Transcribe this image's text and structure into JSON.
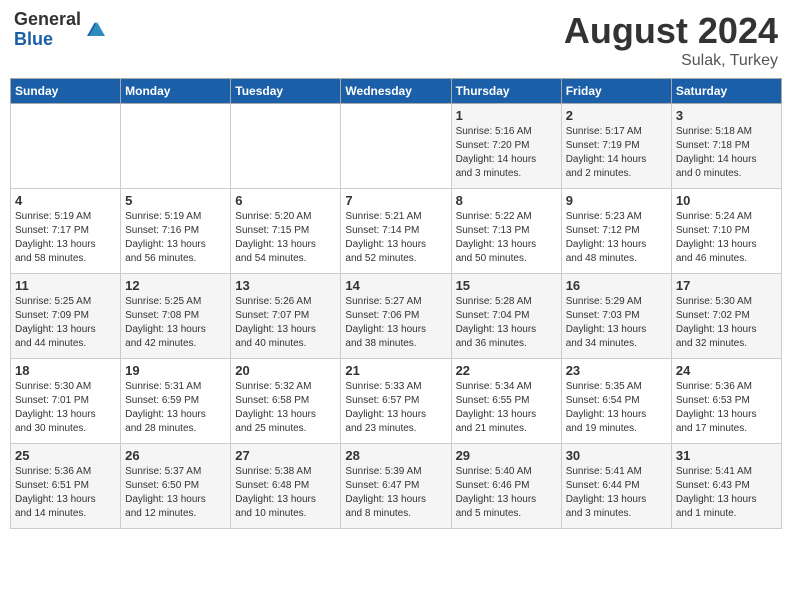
{
  "logo": {
    "general": "General",
    "blue": "Blue"
  },
  "title": "August 2024",
  "location": "Sulak, Turkey",
  "days_of_week": [
    "Sunday",
    "Monday",
    "Tuesday",
    "Wednesday",
    "Thursday",
    "Friday",
    "Saturday"
  ],
  "weeks": [
    [
      {
        "day": "",
        "info": ""
      },
      {
        "day": "",
        "info": ""
      },
      {
        "day": "",
        "info": ""
      },
      {
        "day": "",
        "info": ""
      },
      {
        "day": "1",
        "info": "Sunrise: 5:16 AM\nSunset: 7:20 PM\nDaylight: 14 hours\nand 3 minutes."
      },
      {
        "day": "2",
        "info": "Sunrise: 5:17 AM\nSunset: 7:19 PM\nDaylight: 14 hours\nand 2 minutes."
      },
      {
        "day": "3",
        "info": "Sunrise: 5:18 AM\nSunset: 7:18 PM\nDaylight: 14 hours\nand 0 minutes."
      }
    ],
    [
      {
        "day": "4",
        "info": "Sunrise: 5:19 AM\nSunset: 7:17 PM\nDaylight: 13 hours\nand 58 minutes."
      },
      {
        "day": "5",
        "info": "Sunrise: 5:19 AM\nSunset: 7:16 PM\nDaylight: 13 hours\nand 56 minutes."
      },
      {
        "day": "6",
        "info": "Sunrise: 5:20 AM\nSunset: 7:15 PM\nDaylight: 13 hours\nand 54 minutes."
      },
      {
        "day": "7",
        "info": "Sunrise: 5:21 AM\nSunset: 7:14 PM\nDaylight: 13 hours\nand 52 minutes."
      },
      {
        "day": "8",
        "info": "Sunrise: 5:22 AM\nSunset: 7:13 PM\nDaylight: 13 hours\nand 50 minutes."
      },
      {
        "day": "9",
        "info": "Sunrise: 5:23 AM\nSunset: 7:12 PM\nDaylight: 13 hours\nand 48 minutes."
      },
      {
        "day": "10",
        "info": "Sunrise: 5:24 AM\nSunset: 7:10 PM\nDaylight: 13 hours\nand 46 minutes."
      }
    ],
    [
      {
        "day": "11",
        "info": "Sunrise: 5:25 AM\nSunset: 7:09 PM\nDaylight: 13 hours\nand 44 minutes."
      },
      {
        "day": "12",
        "info": "Sunrise: 5:25 AM\nSunset: 7:08 PM\nDaylight: 13 hours\nand 42 minutes."
      },
      {
        "day": "13",
        "info": "Sunrise: 5:26 AM\nSunset: 7:07 PM\nDaylight: 13 hours\nand 40 minutes."
      },
      {
        "day": "14",
        "info": "Sunrise: 5:27 AM\nSunset: 7:06 PM\nDaylight: 13 hours\nand 38 minutes."
      },
      {
        "day": "15",
        "info": "Sunrise: 5:28 AM\nSunset: 7:04 PM\nDaylight: 13 hours\nand 36 minutes."
      },
      {
        "day": "16",
        "info": "Sunrise: 5:29 AM\nSunset: 7:03 PM\nDaylight: 13 hours\nand 34 minutes."
      },
      {
        "day": "17",
        "info": "Sunrise: 5:30 AM\nSunset: 7:02 PM\nDaylight: 13 hours\nand 32 minutes."
      }
    ],
    [
      {
        "day": "18",
        "info": "Sunrise: 5:30 AM\nSunset: 7:01 PM\nDaylight: 13 hours\nand 30 minutes."
      },
      {
        "day": "19",
        "info": "Sunrise: 5:31 AM\nSunset: 6:59 PM\nDaylight: 13 hours\nand 28 minutes."
      },
      {
        "day": "20",
        "info": "Sunrise: 5:32 AM\nSunset: 6:58 PM\nDaylight: 13 hours\nand 25 minutes."
      },
      {
        "day": "21",
        "info": "Sunrise: 5:33 AM\nSunset: 6:57 PM\nDaylight: 13 hours\nand 23 minutes."
      },
      {
        "day": "22",
        "info": "Sunrise: 5:34 AM\nSunset: 6:55 PM\nDaylight: 13 hours\nand 21 minutes."
      },
      {
        "day": "23",
        "info": "Sunrise: 5:35 AM\nSunset: 6:54 PM\nDaylight: 13 hours\nand 19 minutes."
      },
      {
        "day": "24",
        "info": "Sunrise: 5:36 AM\nSunset: 6:53 PM\nDaylight: 13 hours\nand 17 minutes."
      }
    ],
    [
      {
        "day": "25",
        "info": "Sunrise: 5:36 AM\nSunset: 6:51 PM\nDaylight: 13 hours\nand 14 minutes."
      },
      {
        "day": "26",
        "info": "Sunrise: 5:37 AM\nSunset: 6:50 PM\nDaylight: 13 hours\nand 12 minutes."
      },
      {
        "day": "27",
        "info": "Sunrise: 5:38 AM\nSunset: 6:48 PM\nDaylight: 13 hours\nand 10 minutes."
      },
      {
        "day": "28",
        "info": "Sunrise: 5:39 AM\nSunset: 6:47 PM\nDaylight: 13 hours\nand 8 minutes."
      },
      {
        "day": "29",
        "info": "Sunrise: 5:40 AM\nSunset: 6:46 PM\nDaylight: 13 hours\nand 5 minutes."
      },
      {
        "day": "30",
        "info": "Sunrise: 5:41 AM\nSunset: 6:44 PM\nDaylight: 13 hours\nand 3 minutes."
      },
      {
        "day": "31",
        "info": "Sunrise: 5:41 AM\nSunset: 6:43 PM\nDaylight: 13 hours\nand 1 minute."
      }
    ]
  ]
}
